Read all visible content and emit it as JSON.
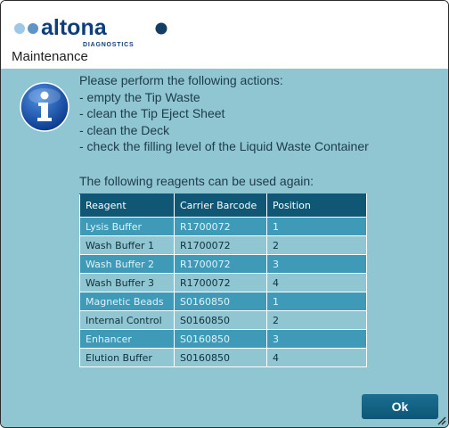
{
  "logo": {
    "brand": "altona",
    "sub": "DIAGNOSTICS",
    "colors": {
      "dot_light": "#9ec8e6",
      "dot_dark": "#123e66",
      "text": "#0e3f7a"
    }
  },
  "dialog": {
    "title": "Maintenance",
    "icon": "info-icon"
  },
  "message": {
    "heading": "Please perform the following actions:",
    "actions": [
      "- empty the Tip Waste",
      "- clean the Tip Eject Sheet",
      "- clean the Deck",
      "- check the filling level of the Liquid Waste Container"
    ]
  },
  "reagents": {
    "title": "The following reagents can be used again:",
    "headers": [
      "Reagent",
      "Carrier Barcode",
      "Position"
    ],
    "rows": [
      [
        "Lysis Buffer",
        "R1700072",
        "1"
      ],
      [
        "Wash Buffer 1",
        "R1700072",
        "2"
      ],
      [
        "Wash Buffer 2",
        "R1700072",
        "3"
      ],
      [
        "Wash Buffer 3",
        "R1700072",
        "4"
      ],
      [
        "Magnetic Beads",
        "S0160850",
        "1"
      ],
      [
        "Internal Control",
        "S0160850",
        "2"
      ],
      [
        "Enhancer",
        "S0160850",
        "3"
      ],
      [
        "Elution Buffer",
        "S0160850",
        "4"
      ]
    ]
  },
  "buttons": {
    "ok_label": "Ok"
  },
  "colors": {
    "content_bg": "#8fc6d2",
    "table_header": "#0f5774",
    "row_dark": "#3e9ab7",
    "row_light": "#8fc6d2",
    "button": "#0d5675"
  }
}
